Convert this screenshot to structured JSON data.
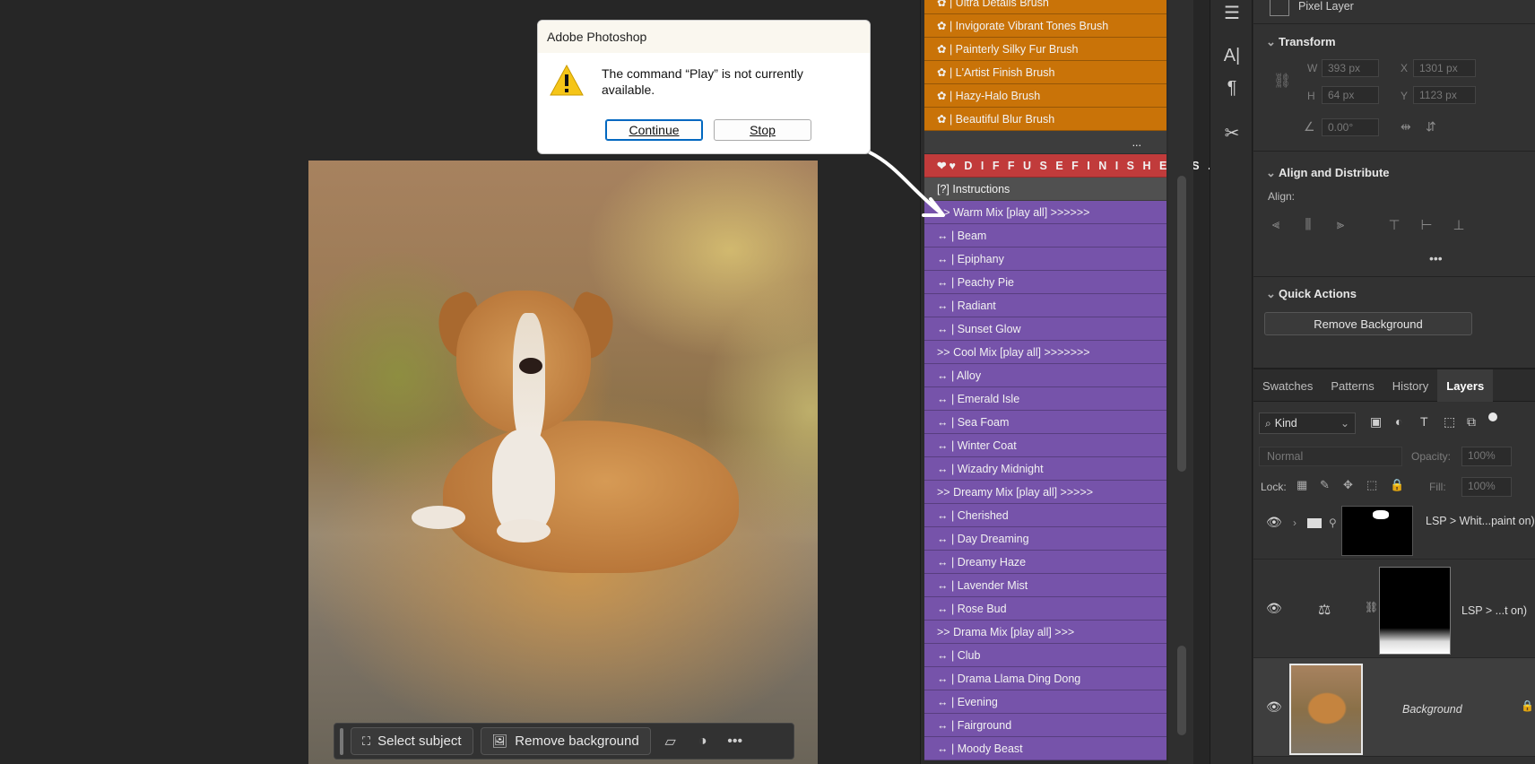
{
  "dialog": {
    "title": "Adobe Photoshop",
    "message": "The command “Play” is not currently available.",
    "continue_label": "Continue",
    "stop_label": "Stop"
  },
  "context_bar": {
    "select_subject": "Select subject",
    "remove_background": "Remove background"
  },
  "actions": {
    "rows": [
      {
        "label": "✿ |  Ultra Details Brush",
        "color": "orange"
      },
      {
        "label": "✿ |  Invigorate Vibrant Tones Brush",
        "color": "orange"
      },
      {
        "label": "✿ |  Painterly Silky Fur Brush",
        "color": "orange"
      },
      {
        "label": "✿ |  L'Artist Finish Brush",
        "color": "orange"
      },
      {
        "label": "✿ |  Hazy-Halo Brush",
        "color": "orange"
      },
      {
        "label": "✿ |  Beautiful Blur Brush",
        "color": "orange"
      },
      {
        "label": "...",
        "color": "dark"
      },
      {
        "label": "❤♥  D I F F U S E  F I N I S H E R S  ...",
        "color": "red"
      },
      {
        "label": "[?]   Instructions",
        "color": "gray"
      },
      {
        "label": ">> Warm Mix [play all] >>>>>>",
        "color": "purple"
      },
      {
        "label": "↔ |  Beam",
        "color": "purple"
      },
      {
        "label": "↔ |  Epiphany",
        "color": "purple"
      },
      {
        "label": "↔ |  Peachy Pie",
        "color": "purple"
      },
      {
        "label": "↔ |  Radiant",
        "color": "purple"
      },
      {
        "label": "↔ |  Sunset Glow",
        "color": "purple"
      },
      {
        "label": ">> Cool Mix [play all] >>>>>>>",
        "color": "purple"
      },
      {
        "label": "↔ |  Alloy",
        "color": "purple"
      },
      {
        "label": "↔ |  Emerald Isle",
        "color": "purple"
      },
      {
        "label": "↔ |  Sea Foam",
        "color": "purple"
      },
      {
        "label": "↔ |  Winter Coat",
        "color": "purple"
      },
      {
        "label": "↔ |  Wizadry Midnight",
        "color": "purple"
      },
      {
        "label": ">> Dreamy Mix [play all] >>>>>",
        "color": "purple"
      },
      {
        "label": "↔ |  Cherished",
        "color": "purple"
      },
      {
        "label": "↔ |  Day Dreaming",
        "color": "purple"
      },
      {
        "label": "↔ |  Dreamy Haze",
        "color": "purple"
      },
      {
        "label": "↔ |  Lavender Mist",
        "color": "purple"
      },
      {
        "label": "↔ |  Rose Bud",
        "color": "purple"
      },
      {
        "label": ">> Drama Mix [play all] >>>",
        "color": "purple"
      },
      {
        "label": "↔ |  Club",
        "color": "purple"
      },
      {
        "label": "↔ |  Drama Llama Ding Dong",
        "color": "purple"
      },
      {
        "label": "↔ |  Evening",
        "color": "purple"
      },
      {
        "label": "↔ |  Fairground",
        "color": "purple"
      },
      {
        "label": "↔ |  Moody Beast",
        "color": "purple"
      }
    ]
  },
  "properties": {
    "layer_type": "Pixel Layer",
    "transform_title": "Transform",
    "w_label": "W",
    "w_value": "393 px",
    "h_label": "H",
    "h_value": "64 px",
    "x_label": "X",
    "x_value": "1301 px",
    "y_label": "Y",
    "y_value": "1123 px",
    "angle_value": "0.00°",
    "align_title": "Align and Distribute",
    "align_label": "Align:",
    "quick_title": "Quick Actions",
    "remove_bg_label": "Remove Background"
  },
  "layers_panel": {
    "tabs": [
      "Swatches",
      "Patterns",
      "History",
      "Layers"
    ],
    "active_tab": "Layers",
    "kind_label": "Kind",
    "blend_mode": "Normal",
    "opacity_label": "Opacity:",
    "opacity_value": "100%",
    "lock_label": "Lock:",
    "fill_label": "Fill:",
    "fill_value": "100%",
    "layers": [
      {
        "name": "LSP > Whit...paint on)"
      },
      {
        "name": "LSP > ...t on)"
      },
      {
        "name": "Background"
      }
    ]
  },
  "colors": {
    "orange": "#c97308",
    "purple": "#7653aa",
    "red": "#c13b3b"
  }
}
